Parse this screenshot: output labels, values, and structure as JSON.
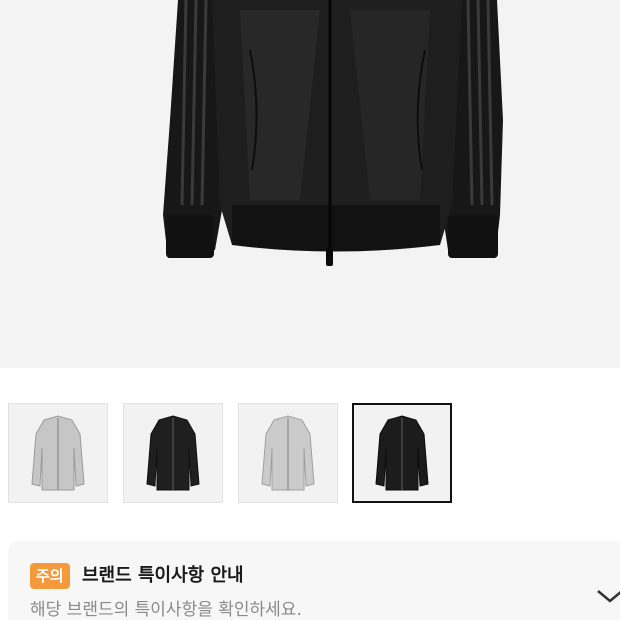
{
  "product": {
    "main_image": {
      "icon": "black-track-jacket-image"
    },
    "thumbnails": [
      {
        "label": "silver-jacket-thumbnail",
        "color": "#c9c9c9",
        "selected": false
      },
      {
        "label": "black-jacket-thumbnail",
        "color": "#1f1f1f",
        "selected": false
      },
      {
        "label": "silver-jacket-thumbnail",
        "color": "#c9c9c9",
        "selected": false
      },
      {
        "label": "black-jacket-thumbnail",
        "color": "#1f1f1f",
        "selected": true
      }
    ]
  },
  "notice": {
    "badge": "주의",
    "title": "브랜드 특이사항 안내",
    "description": "해당 브랜드의 특이사항을 확인하세요.",
    "badge_color": "#f59a3b",
    "expand_icon": "chevron-down-icon"
  }
}
